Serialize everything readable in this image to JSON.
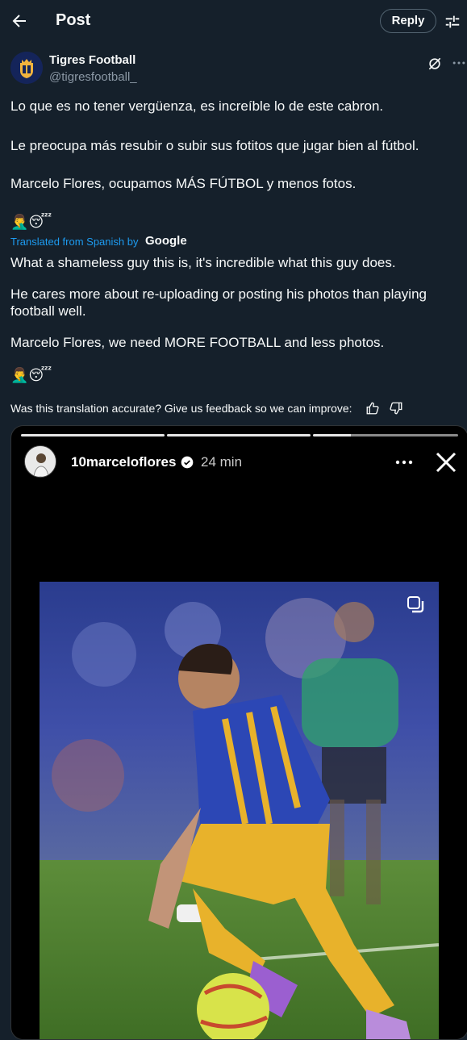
{
  "header": {
    "title": "Post",
    "reply_label": "Reply"
  },
  "author": {
    "name": "Tigres Football",
    "handle": "@tigresfootball_"
  },
  "post": {
    "original": [
      "Lo que es no tener vergüenza, es increíble lo de este cabron.",
      "Le preocupa más resubir o subir sus fotitos que jugar bien al fútbol.",
      "Marcelo Flores, ocupamos MÁS FÚTBOL y menos fotos."
    ],
    "original_emojis": "🤦‍♂️😴",
    "translated_from": "Translated from Spanish by",
    "translator": "Google",
    "translation": [
      "What a shameless guy this is, it's incredible what this guy does.",
      "He cares more about re-uploading or posting his photos than playing football well.",
      "Marcelo Flores, we need MORE FOOTBALL and less photos."
    ],
    "translation_emojis": "🤦‍♂️😴",
    "feedback_prompt": "Was this translation accurate? Give us feedback so we can improve:"
  },
  "story": {
    "username": "10marceloflores",
    "time": "24 min",
    "progress_segments": 3
  },
  "colors": {
    "background": "#15202b",
    "accent": "#1d9bf0",
    "muted": "#8b98a5"
  }
}
